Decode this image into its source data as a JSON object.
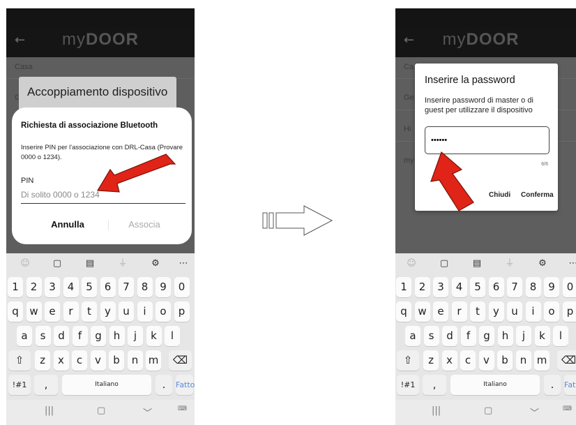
{
  "left_screen": {
    "back_icon": "arrow-left-icon",
    "app_title_prefix": "my",
    "app_title_brand": "DOOR",
    "list_items": [
      "Casa",
      "Ge"
    ],
    "background_dialog_title": "Accoppiamento dispositivo",
    "bt_dialog": {
      "title": "Richiesta di associazione Bluetooth",
      "message": "Inserire PIN per l'associazione con DRL-Casa (Provare 0000 o 1234).",
      "pin_label": "PIN",
      "pin_placeholder": "Di solito 0000 o 1234",
      "pin_value": "",
      "cancel_label": "Annulla",
      "pair_label": "Associa"
    }
  },
  "right_screen": {
    "back_icon": "arrow-left-icon",
    "app_title_prefix": "my",
    "app_title_brand": "DOOR",
    "list_items": [
      "Ca",
      "Ge",
      "Hi",
      "my"
    ],
    "pw_dialog": {
      "title": "Inserire la password",
      "message": "Inserire password di master o di guest per utilizzare il dispositivo",
      "password_value": "••••••",
      "counter": "6/6",
      "close_label": "Chiudi",
      "confirm_label": "Conferma"
    }
  },
  "keyboard": {
    "toolbar_icons": [
      "emoji-icon",
      "clipboard-icon",
      "text-edit-icon",
      "microphone-icon",
      "settings-icon",
      "more-icon"
    ],
    "number_row": [
      "1",
      "2",
      "3",
      "4",
      "5",
      "6",
      "7",
      "8",
      "9",
      "0"
    ],
    "row1": [
      "q",
      "w",
      "e",
      "r",
      "t",
      "y",
      "u",
      "i",
      "o",
      "p"
    ],
    "row2": [
      "a",
      "s",
      "d",
      "f",
      "g",
      "h",
      "j",
      "k",
      "l"
    ],
    "row3": [
      "z",
      "x",
      "c",
      "v",
      "b",
      "n",
      "m"
    ],
    "shift_icon": "shift-icon",
    "backspace_icon": "backspace-icon",
    "symbols_label": "!#1",
    "comma_label": ",",
    "space_label": "Italiano",
    "period_label": ".",
    "done_label": "Fatto",
    "nav_icons": [
      "recents-icon",
      "home-icon",
      "back-chevron-icon",
      "keyboard-icon"
    ]
  },
  "annotation": {
    "arrow_color": "#e02418",
    "transition_arrow": "right-arrow-icon"
  }
}
